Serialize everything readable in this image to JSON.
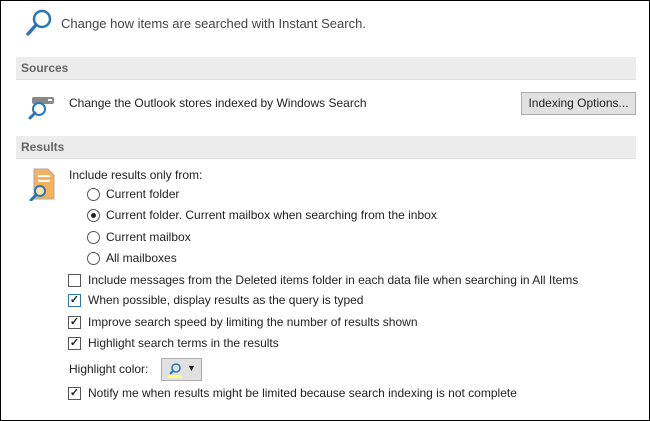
{
  "header": {
    "title": "Change how items are searched with Instant Search."
  },
  "sources": {
    "heading": "Sources",
    "description": "Change the Outlook stores indexed by Windows Search",
    "button": "Indexing Options..."
  },
  "results": {
    "heading": "Results",
    "include_label": "Include results only from:",
    "radios": [
      {
        "label": "Current folder",
        "selected": false
      },
      {
        "label": "Current folder. Current mailbox when searching from the inbox",
        "selected": true
      },
      {
        "label": "Current mailbox",
        "selected": false
      },
      {
        "label": "All mailboxes",
        "selected": false
      }
    ],
    "checkboxes": [
      {
        "label": "Include messages from the Deleted items folder in each data file when searching in All Items",
        "checked": false
      },
      {
        "label": "When possible, display results as the query is typed",
        "checked": true
      },
      {
        "label": "Improve search speed by limiting the number of results shown",
        "checked": true
      },
      {
        "label": "Highlight search terms in the results",
        "checked": true
      }
    ],
    "highlight_label": "Highlight color:",
    "highlight_color": "#ffff66",
    "notify": {
      "label": "Notify me when results might be limited because search indexing is not complete",
      "checked": true
    }
  },
  "colors": {
    "accent": "#2e75b6"
  }
}
